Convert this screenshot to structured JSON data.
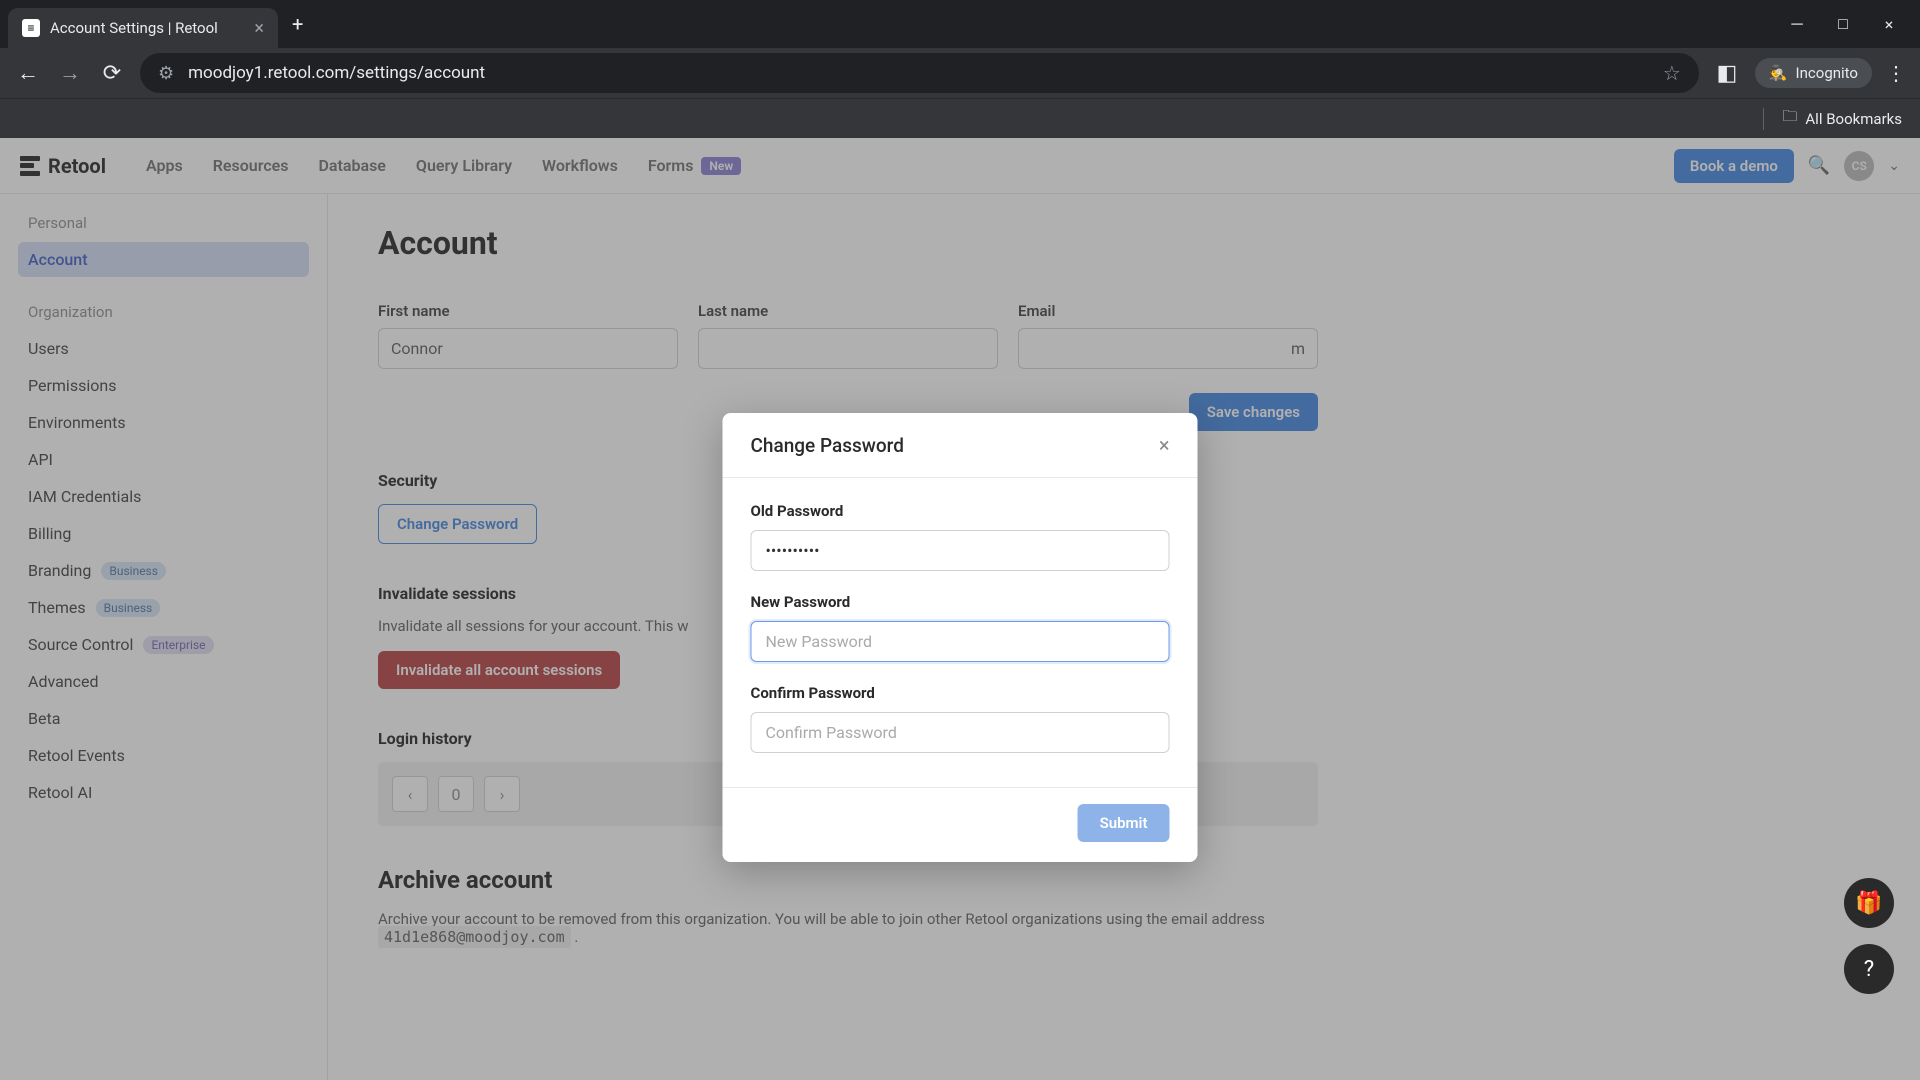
{
  "browser": {
    "tab_title": "Account Settings | Retool",
    "url": "moodjoy1.retool.com/settings/account",
    "incognito_label": "Incognito",
    "bookmarks_label": "All Bookmarks"
  },
  "header": {
    "logo_text": "Retool",
    "nav": [
      "Apps",
      "Resources",
      "Database",
      "Query Library",
      "Workflows",
      "Forms"
    ],
    "forms_badge": "New",
    "book_demo": "Book a demo",
    "avatar_initials": "CS"
  },
  "sidebar": {
    "sections": [
      {
        "label": "Personal",
        "items": [
          {
            "label": "Account",
            "active": true
          }
        ]
      },
      {
        "label": "Organization",
        "items": [
          {
            "label": "Users"
          },
          {
            "label": "Permissions"
          },
          {
            "label": "Environments"
          },
          {
            "label": "API"
          },
          {
            "label": "IAM Credentials"
          },
          {
            "label": "Billing"
          },
          {
            "label": "Branding",
            "badge": "Business",
            "badge_class": "badge-business"
          },
          {
            "label": "Themes",
            "badge": "Business",
            "badge_class": "badge-business"
          },
          {
            "label": "Source Control",
            "badge": "Enterprise",
            "badge_class": "badge-enterprise"
          },
          {
            "label": "Advanced"
          },
          {
            "label": "Beta"
          },
          {
            "label": "Retool Events"
          },
          {
            "label": "Retool AI"
          }
        ]
      }
    ]
  },
  "page": {
    "title": "Account",
    "first_name_label": "First name",
    "first_name_value": "Connor",
    "last_name_label": "Last name",
    "email_label": "Email",
    "email_suffix": "m",
    "save_changes": "Save changes",
    "security_title": "Security",
    "change_password": "Change Password",
    "invalidate_title": "Invalidate sessions",
    "invalidate_text": "Invalidate all sessions for your account. This w",
    "invalidate_button": "Invalidate all account sessions",
    "login_history_title": "Login history",
    "login_history_page": "0",
    "archive_title": "Archive account",
    "archive_text_1": "Archive your account to be removed from this organization. You will be able to join other Retool organizations using the email address ",
    "archive_email": "41d1e868@moodjoy.com",
    "archive_text_2": " ."
  },
  "modal": {
    "title": "Change Password",
    "old_password_label": "Old Password",
    "old_password_value": "••••••••••",
    "new_password_label": "New Password",
    "new_password_placeholder": "New Password",
    "confirm_password_label": "Confirm Password",
    "confirm_password_placeholder": "Confirm Password",
    "submit": "Submit"
  }
}
